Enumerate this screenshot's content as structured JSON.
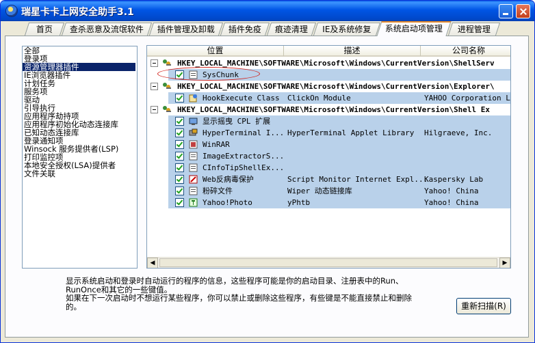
{
  "window": {
    "title": "瑞星卡卡上网安全助手3.1"
  },
  "tabs": [
    {
      "label": "首页"
    },
    {
      "label": "查杀恶意及流氓软件"
    },
    {
      "label": "插件管理及卸载"
    },
    {
      "label": "插件免疫"
    },
    {
      "label": "痕迹清理"
    },
    {
      "label": "IE及系统修复"
    },
    {
      "label": "系统启动项管理"
    },
    {
      "label": "进程管理"
    }
  ],
  "active_tab": "系统启动项管理",
  "categories": [
    {
      "label": "全部"
    },
    {
      "label": "登录项"
    },
    {
      "label": "资源管理器插件"
    },
    {
      "label": "IE浏览器插件"
    },
    {
      "label": "计划任务"
    },
    {
      "label": "服务项"
    },
    {
      "label": "驱动"
    },
    {
      "label": "引导执行"
    },
    {
      "label": "应用程序劫持项"
    },
    {
      "label": "应用程序初始化动态连接库"
    },
    {
      "label": "已知动态连接库"
    },
    {
      "label": "登录通知项"
    },
    {
      "label": "Winsock 服务提供者(LSP)"
    },
    {
      "label": "打印监控项"
    },
    {
      "label": "本地安全授权(LSA)提供者"
    },
    {
      "label": "文件关联"
    }
  ],
  "selected_category": "资源管理器插件",
  "columns": {
    "location": "位置",
    "description": "描述",
    "company": "公司名称"
  },
  "groups": [
    {
      "key": "HKEY_LOCAL_MACHINE\\SOFTWARE\\Microsoft\\Windows\\CurrentVersion\\ShellServ",
      "items": [
        {
          "name": "SysChunk",
          "description": "",
          "company": "",
          "checked": true
        }
      ]
    },
    {
      "key": "HKEY_LOCAL_MACHINE\\SOFTWARE\\Microsoft\\Windows\\CurrentVersion\\Explorer\\",
      "items": [
        {
          "name": "HookExecute Class",
          "description": "ClickOn Module",
          "company": "YAHOO Corporation Lim",
          "checked": true
        }
      ]
    },
    {
      "key": "HKEY_LOCAL_MACHINE\\SOFTWARE\\Microsoft\\Windows\\CurrentVersion\\Shell Ex",
      "items": [
        {
          "name": "显示摇曳 CPL 扩展",
          "description": "",
          "company": "",
          "checked": true
        },
        {
          "name": "HyperTerminal I...",
          "description": "HyperTerminal Applet Library",
          "company": "Hilgraeve, Inc.",
          "checked": true
        },
        {
          "name": "WinRAR",
          "description": "",
          "company": "",
          "checked": true
        },
        {
          "name": "ImageExtractorS...",
          "description": "",
          "company": "",
          "checked": true
        },
        {
          "name": "CInfoTipShellEx...",
          "description": "",
          "company": "",
          "checked": true
        },
        {
          "name": "Web反病毒保护",
          "description": "Script Monitor Internet Expl...",
          "company": "Kaspersky Lab",
          "checked": true
        },
        {
          "name": "粉碎文件",
          "description": "Wiper 动态链接库",
          "company": "Yahoo! China",
          "checked": true
        },
        {
          "name": "Yahoo!Photo",
          "description": "yPhtb",
          "company": "Yahoo! China",
          "checked": true
        }
      ]
    }
  ],
  "info": {
    "line1": "显示系统启动和登录时自动运行的程序的信息，这些程序可能是你的启动目录、注册表中的Run、",
    "line2": "RunOnce和其它的一些键值。",
    "line3": "如果在下一次启动时不想运行某些程序，你可以禁止或删除这些程序，有些键是不能直接禁止和删除",
    "line4": "的。"
  },
  "buttons": {
    "rescan": "重新扫描(R)"
  },
  "colors": {
    "selection": "#0a246a",
    "row_highlight": "#b9d1ea",
    "title_bar": "#0055e5",
    "annotation": "#d2211a"
  }
}
